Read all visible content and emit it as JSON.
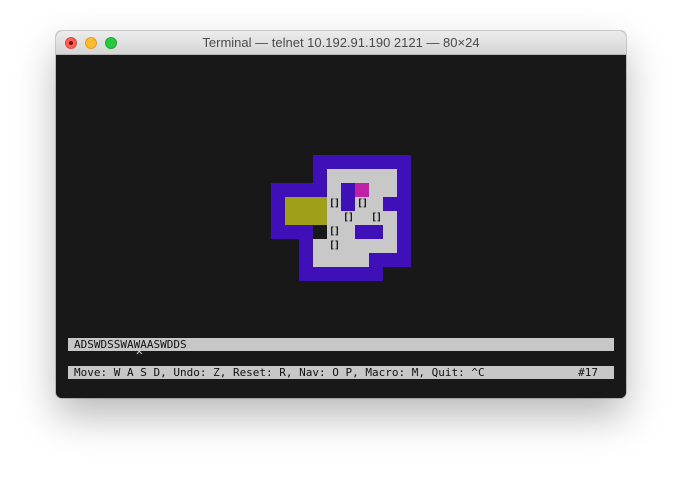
{
  "window": {
    "title": "Terminal — telnet 10.192.91.190 2121 — 80×24"
  },
  "colors": {
    "terminal_bg": "#181818",
    "wall": "#3f10b8",
    "floor": "#c8c8c8",
    "goal": "#a0a018",
    "player": "#c020a8",
    "status_bar": "#c7c7c7"
  },
  "game": {
    "box_glyph": "[]",
    "moves": "ADSWDSSWAWAASWDDS",
    "cursor_glyph": "^",
    "help": "Move: W A S D, Undo: Z, Reset: R, Nav: O P, Macro: M, Quit: ^C",
    "level": "#17"
  }
}
